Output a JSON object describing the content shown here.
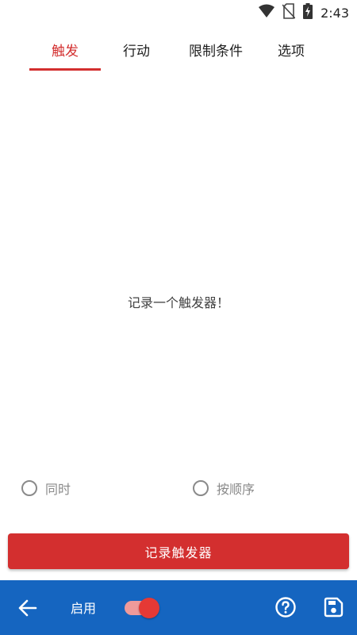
{
  "status_bar": {
    "time": "2:43",
    "icons": [
      "wifi-icon",
      "no-sim-icon",
      "battery-charging-icon"
    ]
  },
  "tabs": [
    {
      "label": "触发",
      "active": true
    },
    {
      "label": "行动",
      "active": false
    },
    {
      "label": "限制条件",
      "active": false
    },
    {
      "label": "选项",
      "active": false
    }
  ],
  "main": {
    "empty_message": "记录一个触发器！"
  },
  "trigger_mode": {
    "options": [
      {
        "label": "同时",
        "selected": false
      },
      {
        "label": "按顺序",
        "selected": false
      }
    ]
  },
  "record_button": {
    "label": "记录触发器"
  },
  "bottom_bar": {
    "enable_label": "启用",
    "enabled": true,
    "icons": [
      "back-arrow-icon",
      "help-icon",
      "save-icon"
    ]
  },
  "colors": {
    "accent": "#d32f2f",
    "bottom_bar": "#1565c0",
    "switch_thumb": "#e53935",
    "switch_track": "#ef9a9a"
  }
}
